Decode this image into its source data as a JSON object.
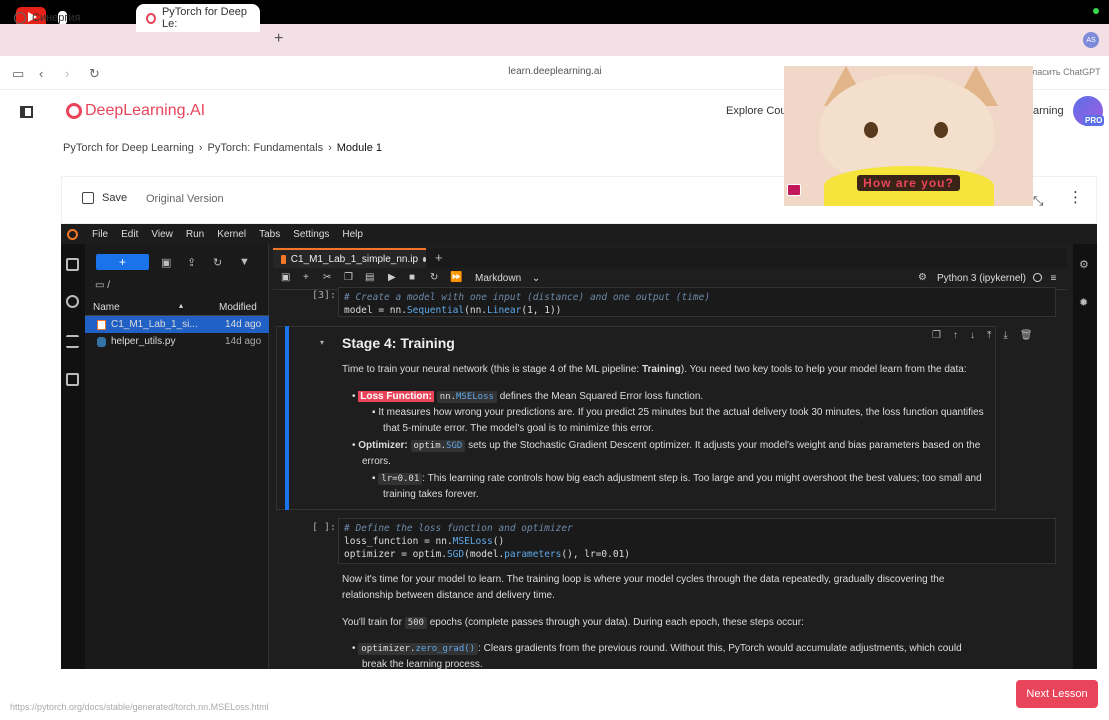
{
  "browser": {
    "tabs": [
      {
        "label": "Синергия"
      },
      {
        "label": "PyTorch for Deep Le:"
      }
    ],
    "url": "learn.deeplearning.ai",
    "chatgpt_text": "ласить ChatGPT",
    "profile_initials": "AS"
  },
  "site": {
    "logo_text": "DeepLearning.AI",
    "explore_label": "Explore Cou",
    "learning_label": "arning",
    "pro_label": "PRO",
    "breadcrumb": [
      "PyTorch for Deep Learning",
      "PyTorch: Fundamentals",
      "Module 1"
    ],
    "save_label": "Save",
    "original_version_label": "Original Version",
    "next_lesson_label": "Next Lesson",
    "status_url": "https://pytorch.org/docs/stable/generated/torch.nn.MSELoss.html"
  },
  "jupyter": {
    "menu": [
      "File",
      "Edit",
      "View",
      "Run",
      "Kernel",
      "Tabs",
      "Settings",
      "Help"
    ],
    "new_button": "+",
    "path": "/",
    "columns": {
      "name": "Name",
      "modified": "Modified"
    },
    "files": [
      {
        "name": "C1_M1_Lab_1_si...",
        "modified": "14d ago"
      },
      {
        "name": "helper_utils.py",
        "modified": "14d ago"
      }
    ],
    "notebook_tab": "C1_M1_Lab_1_simple_nn.ip",
    "cell_type": "Markdown",
    "kernel": "Python 3 (ipykernel)",
    "cell3": {
      "prompt": "[3]:",
      "line1": "# Create a model with one input (distance) and one output (time)",
      "line2_pre": "model = nn.",
      "line2_fn": "Sequential",
      "line2_mid": "(nn.",
      "line2_fn2": "Linear",
      "line2_args": "(1, 1))"
    },
    "markdown": {
      "heading": "Stage 4: Training",
      "intro_pre": "Time to train your neural network (this is stage 4 of the ML pipeline: ",
      "intro_bold": "Training",
      "intro_post": "). You need two key tools to help your model learn from the data:",
      "loss_label": "Loss Function:",
      "loss_code_pre": "nn.",
      "loss_code_fn": "MSELoss",
      "loss_text": " defines the Mean Squared Error loss function.",
      "loss_sub_1": "It measures how wrong your predictions are. If you predict 25 minutes but the actual delivery took 30 minutes, the loss function quantifies",
      "loss_sub_2": "that 5-minute error. The model's goal is to minimize this error.",
      "opt_label": "Optimizer:",
      "opt_code_pre": "optim.",
      "opt_code_fn": "SGD",
      "opt_text_1": " sets up the Stochastic Gradient Descent optimizer. It adjusts your model's weight and bias parameters based on the",
      "opt_text_2": "errors.",
      "lr_code": "lr=0.01",
      "lr_text_1": ": This learning rate controls how big each adjustment step is. Too large and you might overshoot the best values; too small and",
      "lr_text_2": "training takes forever."
    },
    "cell4": {
      "prompt": "[ ]:",
      "line1": "# Define the loss function and optimizer",
      "line2_pre": "loss_function = nn.",
      "line2_fn": "MSELoss",
      "line2_post": "()",
      "line3_pre": "optimizer = optim.",
      "line3_fn": "SGD",
      "line3_mid": "(model.",
      "line3_fn2": "parameters",
      "line3_post": "(), lr=0.01)"
    },
    "after": {
      "p1_1": "Now it's time for your model to learn. The training loop is where your model cycles through the data repeatedly, gradually discovering the",
      "p1_2": "relationship between distance and delivery time.",
      "p2_pre": "You'll train for ",
      "p2_code": "500",
      "p2_post": " epochs (complete passes through your data). During each epoch, these steps occur:",
      "b1_code_pre": "optimizer.",
      "b1_code_fn": "zero_grad()",
      "b1_text": ": Clears gradients from the previous round. Without this, PyTorch would accumulate adjustments, which could",
      "b1_text2": "break the learning process."
    }
  },
  "overlay": {
    "caption": "How are you?"
  }
}
